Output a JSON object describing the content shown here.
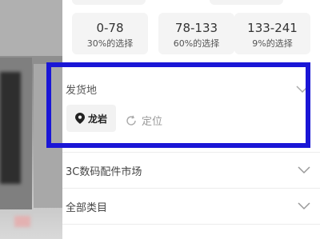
{
  "price_ranges": [
    {
      "range": "0-78",
      "percent": "30%的选择"
    },
    {
      "range": "78-133",
      "percent": "60%的选择"
    },
    {
      "range": "133-241",
      "percent": "9%的选择"
    }
  ],
  "ship_from": {
    "title": "发货地",
    "current_location": "龙岩",
    "locate_label": "定位"
  },
  "categories": [
    {
      "label": "3C数码配件市场"
    },
    {
      "label": "全部类目"
    }
  ],
  "icons": {
    "location_pin": "map-pin-icon",
    "locate": "refresh-icon",
    "expand": "chevron-down-icon"
  },
  "colors": {
    "highlight": "#1a16d6",
    "card_bg": "#f4f4f4"
  }
}
